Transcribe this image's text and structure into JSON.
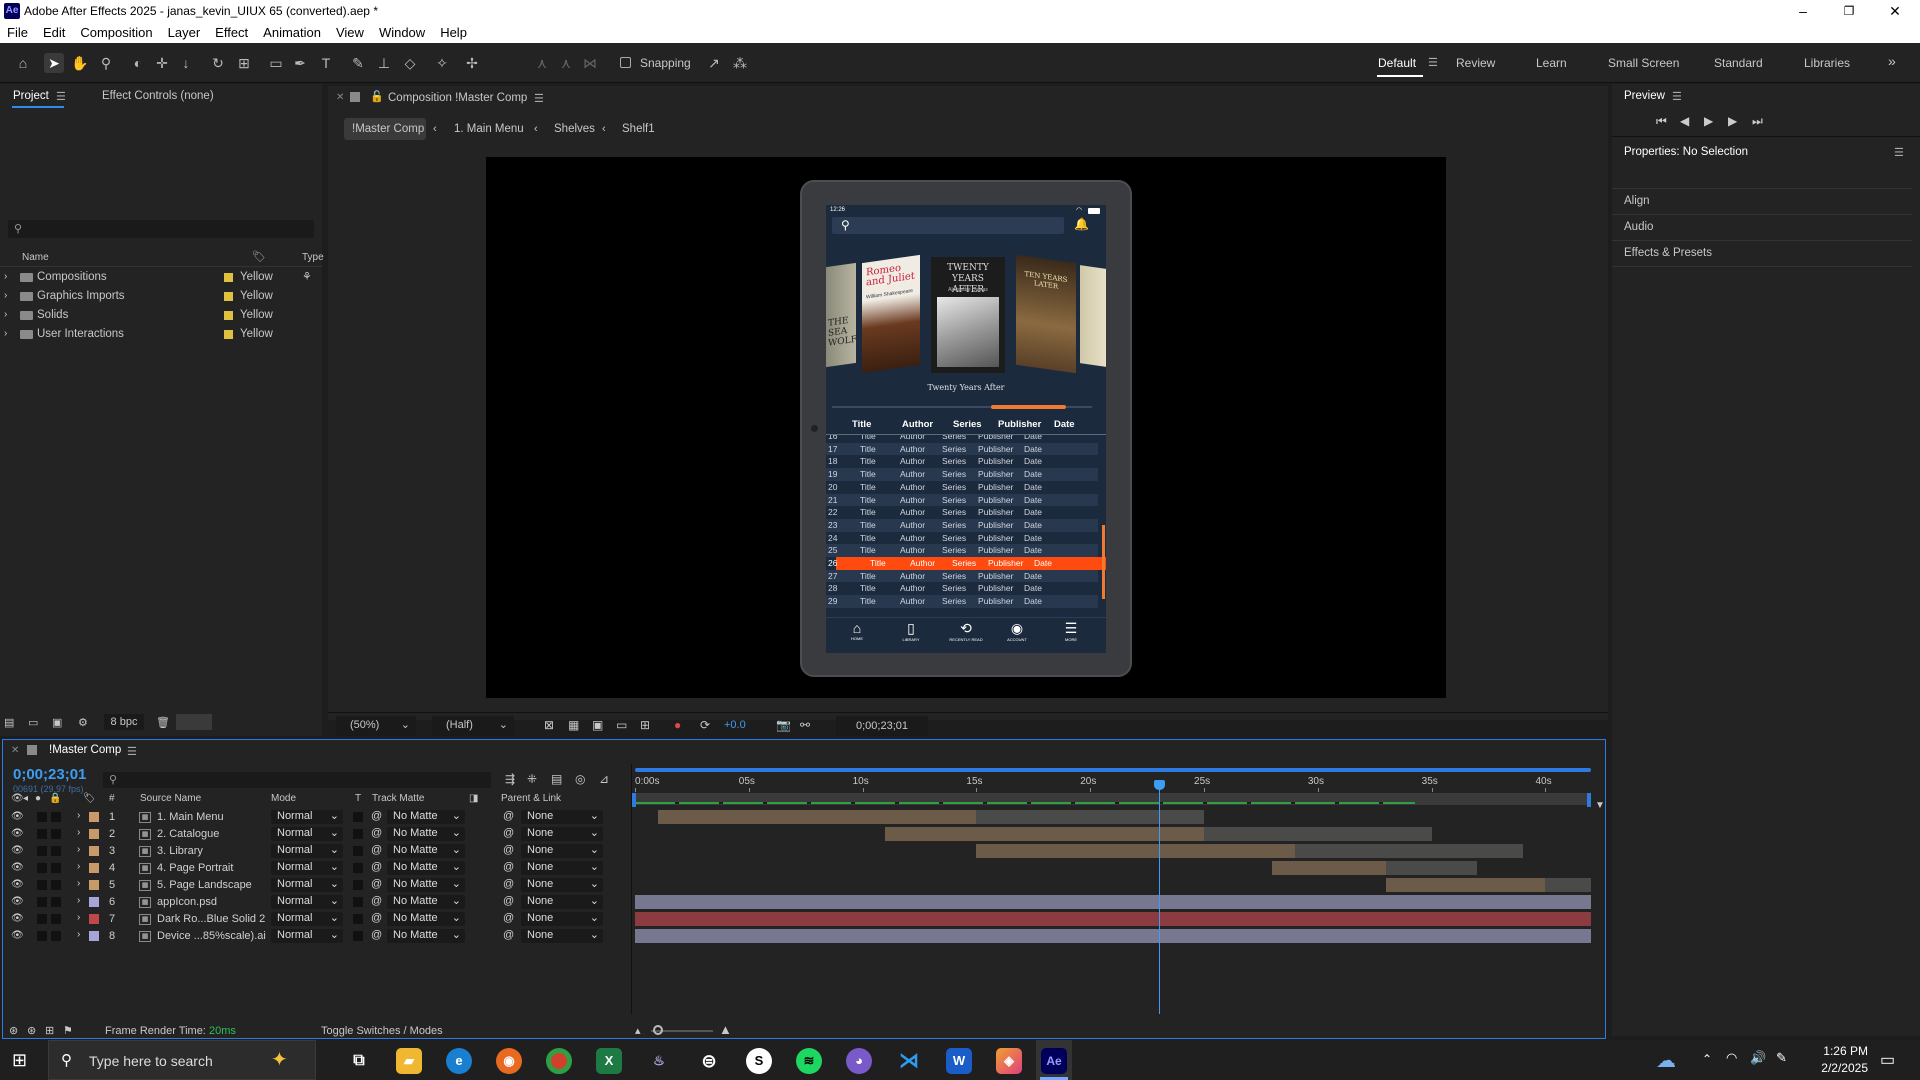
{
  "window": {
    "title": "Adobe After Effects 2025 - janas_kevin_UIUX 65 (converted).aep *",
    "logo": "Ae",
    "minimize": "–",
    "maximize": "❐",
    "close": "✕"
  },
  "menu": [
    "File",
    "Edit",
    "Composition",
    "Layer",
    "Effect",
    "Animation",
    "View",
    "Window",
    "Help"
  ],
  "toolbar": {
    "snapping": "Snapping",
    "workspaces": [
      "Default",
      "Review",
      "Learn",
      "Small Screen",
      "Standard",
      "Libraries"
    ],
    "active_workspace": "Default",
    "more": "»"
  },
  "project": {
    "tab_project": "Project",
    "tab_effect_controls": "Effect Controls (none)",
    "columns": {
      "name": "Name",
      "type": "Type"
    },
    "items": [
      {
        "name": "Compositions",
        "label": "Yellow"
      },
      {
        "name": "Graphics Imports",
        "label": "Yellow"
      },
      {
        "name": "Solids",
        "label": "Yellow"
      },
      {
        "name": "User Interactions",
        "label": "Yellow"
      }
    ],
    "bpc": "8 bpc"
  },
  "composition": {
    "tab": "Composition !Master Comp",
    "breadcrumbs": [
      "!Master Comp",
      "1. Main Menu",
      "Shelves",
      "Shelf1"
    ],
    "zoom": "(50%)",
    "resolution": "(Half)",
    "exposure": "+0.0",
    "timecode": "0;00;23;01"
  },
  "phone": {
    "status_time": "12:26",
    "books": [
      "THE SEA WOLF",
      "Romeo and Juliet",
      "TWENTY YEARS AFTER",
      "TEN YEARS LATER"
    ],
    "book_author": "Alexandre Dumas",
    "book_author_2": "William Shakespeare",
    "selected_book": "Twenty Years After",
    "table_headers": [
      "Title",
      "Author",
      "Series",
      "Publisher",
      "Date"
    ],
    "rows": [
      {
        "n": "16",
        "t": "Title",
        "a": "Author",
        "s": "Series",
        "p": "Publisher",
        "d": "Date"
      },
      {
        "n": "17",
        "t": "Title",
        "a": "Author",
        "s": "Series",
        "p": "Publisher",
        "d": "Date"
      },
      {
        "n": "18",
        "t": "Title",
        "a": "Author",
        "s": "Series",
        "p": "Publisher",
        "d": "Date"
      },
      {
        "n": "19",
        "t": "Title",
        "a": "Author",
        "s": "Series",
        "p": "Publisher",
        "d": "Date"
      },
      {
        "n": "20",
        "t": "Title",
        "a": "Author",
        "s": "Series",
        "p": "Publisher",
        "d": "Date"
      },
      {
        "n": "21",
        "t": "Title",
        "a": "Author",
        "s": "Series",
        "p": "Publisher",
        "d": "Date"
      },
      {
        "n": "22",
        "t": "Title",
        "a": "Author",
        "s": "Series",
        "p": "Publisher",
        "d": "Date"
      },
      {
        "n": "23",
        "t": "Title",
        "a": "Author",
        "s": "Series",
        "p": "Publisher",
        "d": "Date"
      },
      {
        "n": "24",
        "t": "Title",
        "a": "Author",
        "s": "Series",
        "p": "Publisher",
        "d": "Date"
      },
      {
        "n": "25",
        "t": "Title",
        "a": "Author",
        "s": "Series",
        "p": "Publisher",
        "d": "Date"
      },
      {
        "n": "26",
        "t": "Title",
        "a": "Author",
        "s": "Series",
        "p": "Publisher",
        "d": "Date",
        "highlight": true
      },
      {
        "n": "27",
        "t": "Title",
        "a": "Author",
        "s": "Series",
        "p": "Publisher",
        "d": "Date"
      },
      {
        "n": "28",
        "t": "Title",
        "a": "Author",
        "s": "Series",
        "p": "Publisher",
        "d": "Date"
      },
      {
        "n": "29",
        "t": "Title",
        "a": "Author",
        "s": "Series",
        "p": "Publisher",
        "d": "Date"
      }
    ],
    "nav": [
      "HOME",
      "LIBRARY",
      "RECENTLY READ",
      "ACCOUNT",
      "MORE"
    ],
    "highlight_color": "#ff4a10",
    "bg_color": "#1c2a3d"
  },
  "right": {
    "preview": "Preview",
    "properties": "Properties: No Selection",
    "sections": [
      "Align",
      "Audio",
      "Effects & Presets"
    ]
  },
  "timeline": {
    "tab": "!Master Comp",
    "timecode": "0;00;23;01",
    "frame_info": "00691 (29.97 fps)",
    "columns": {
      "num": "#",
      "source": "Source Name",
      "mode": "Mode",
      "t": "T",
      "track_matte": "Track Matte",
      "parent": "Parent & Link"
    },
    "ruler": [
      "0:00s",
      "05s",
      "10s",
      "15s",
      "20s",
      "25s",
      "30s",
      "35s",
      "40s"
    ],
    "current_time_sec": 23.03,
    "duration_sec": 42,
    "layers": [
      {
        "num": "1",
        "name": "1. Main Menu",
        "mode": "Normal",
        "matte": "No Matte",
        "parent": "None",
        "label": "#c89a6a",
        "start": 1,
        "end": 21,
        "bar": "#6b5b48",
        "bar2": "#4a4a48"
      },
      {
        "num": "2",
        "name": "2. Catalogue",
        "mode": "Normal",
        "matte": "No Matte",
        "parent": "None",
        "label": "#c89a6a",
        "start": 11,
        "end": 31,
        "bar": "#6b5b48",
        "bar2": "#4a4a48"
      },
      {
        "num": "3",
        "name": "3. Library",
        "mode": "Normal",
        "matte": "No Matte",
        "parent": "None",
        "label": "#c89a6a",
        "start": 15,
        "end": 35,
        "bar": "#6b5b48",
        "bar2": "#4a4a48"
      },
      {
        "num": "4",
        "name": "4. Page Portrait",
        "mode": "Normal",
        "matte": "No Matte",
        "parent": "None",
        "label": "#c89a6a",
        "start": 28,
        "end": 33,
        "bar": "#6b5b48",
        "bar2": "#4a4a48"
      },
      {
        "num": "5",
        "name": "5. Page Landscape",
        "mode": "Normal",
        "matte": "No Matte",
        "parent": "None",
        "label": "#c89a6a",
        "start": 33,
        "end": 40,
        "bar": "#6b5b48",
        "bar2": "#4a4a48"
      },
      {
        "num": "6",
        "name": "appIcon.psd",
        "mode": "Normal",
        "matte": "No Matte",
        "parent": "None",
        "label": "#a6a6d6",
        "start": 0,
        "end": 42,
        "bar": "#77778f"
      },
      {
        "num": "7",
        "name": "Dark Ro...Blue Solid 2",
        "mode": "Normal",
        "matte": "No Matte",
        "parent": "None",
        "label": "#c04848",
        "start": 0,
        "end": 42,
        "bar": "#8c3c40"
      },
      {
        "num": "8",
        "name": "Device ...85%scale).ai",
        "mode": "Normal",
        "matte": "No Matte",
        "parent": "None",
        "label": "#a6a6d6",
        "start": 0,
        "end": 42,
        "bar": "#77778f"
      }
    ],
    "render_time_label": "Frame Render Time:",
    "render_time_value": "20ms",
    "toggle": "Toggle Switches / Modes"
  },
  "taskbar": {
    "search_placeholder": "Type here to search",
    "time": "1:26 PM",
    "date": "2/2/2025"
  }
}
